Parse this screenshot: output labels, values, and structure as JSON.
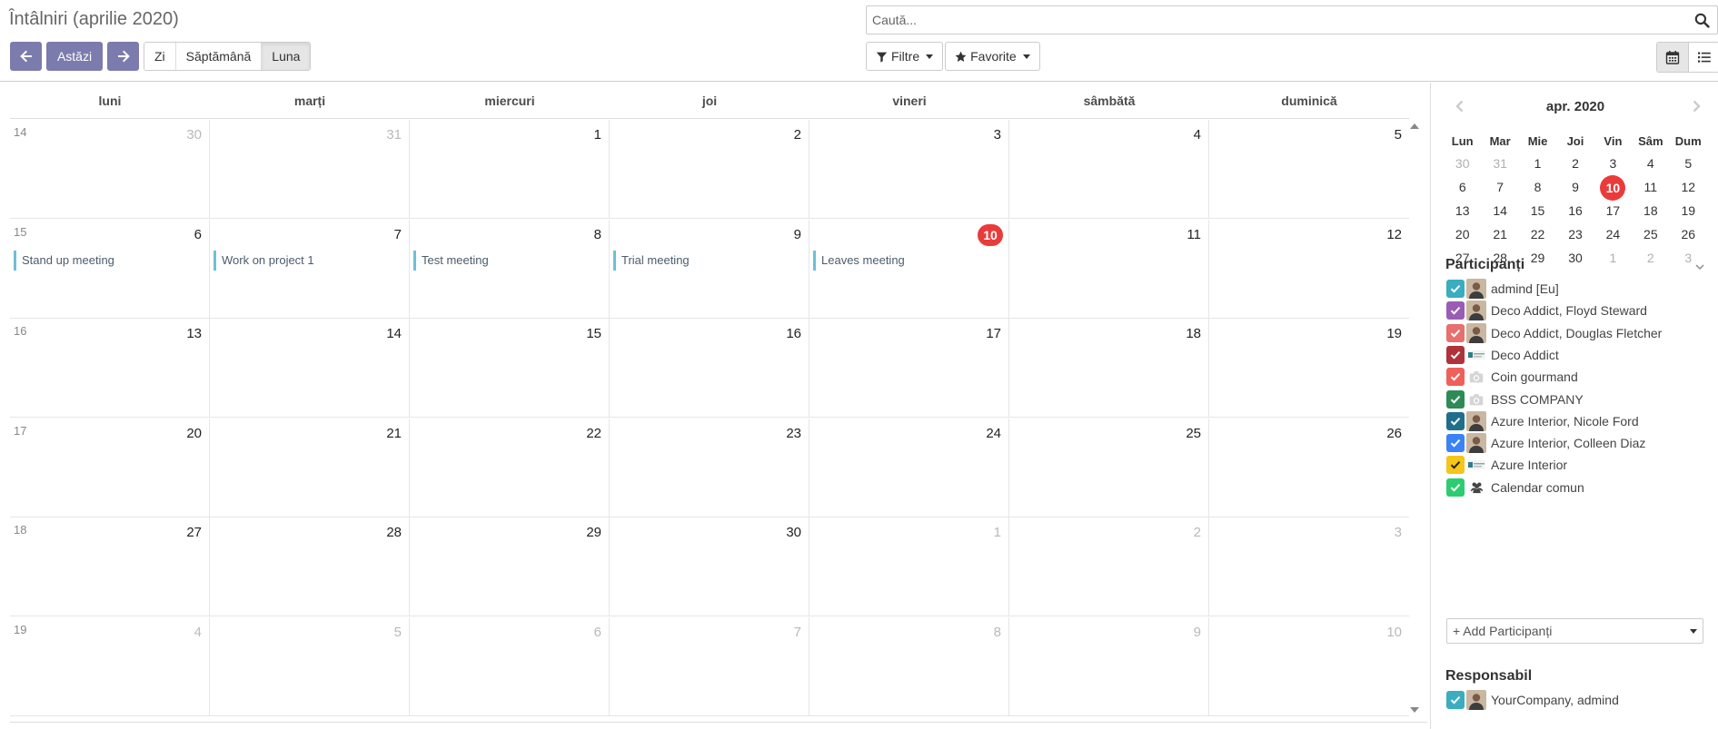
{
  "header": {
    "title": "Întâlniri (aprilie 2020)",
    "today_label": "Astăzi",
    "scales": [
      "Zi",
      "Săptămână",
      "Luna"
    ],
    "active_scale": "Luna",
    "search_placeholder": "Caută...",
    "filters_label": "Filtre",
    "favorites_label": "Favorite"
  },
  "calendar": {
    "weekdays": [
      "luni",
      "marți",
      "miercuri",
      "joi",
      "vineri",
      "sâmbătă",
      "duminică"
    ],
    "weeks": [
      {
        "week_no": "14",
        "days": [
          {
            "n": "30",
            "other": true
          },
          {
            "n": "31",
            "other": true
          },
          {
            "n": "1"
          },
          {
            "n": "2"
          },
          {
            "n": "3"
          },
          {
            "n": "4"
          },
          {
            "n": "5"
          }
        ]
      },
      {
        "week_no": "15",
        "days": [
          {
            "n": "6",
            "event": "Stand up meeting"
          },
          {
            "n": "7",
            "event": "Work on project 1"
          },
          {
            "n": "8",
            "event": "Test meeting"
          },
          {
            "n": "9",
            "event": "Trial meeting"
          },
          {
            "n": "10",
            "today": true,
            "event": "Leaves meeting"
          },
          {
            "n": "11"
          },
          {
            "n": "12"
          }
        ]
      },
      {
        "week_no": "16",
        "days": [
          {
            "n": "13"
          },
          {
            "n": "14"
          },
          {
            "n": "15"
          },
          {
            "n": "16"
          },
          {
            "n": "17"
          },
          {
            "n": "18"
          },
          {
            "n": "19"
          }
        ]
      },
      {
        "week_no": "17",
        "days": [
          {
            "n": "20"
          },
          {
            "n": "21"
          },
          {
            "n": "22"
          },
          {
            "n": "23"
          },
          {
            "n": "24"
          },
          {
            "n": "25"
          },
          {
            "n": "26"
          }
        ]
      },
      {
        "week_no": "18",
        "days": [
          {
            "n": "27"
          },
          {
            "n": "28"
          },
          {
            "n": "29"
          },
          {
            "n": "30"
          },
          {
            "n": "1",
            "other": true
          },
          {
            "n": "2",
            "other": true
          },
          {
            "n": "3",
            "other": true
          }
        ]
      },
      {
        "week_no": "19",
        "days": [
          {
            "n": "4",
            "other": true
          },
          {
            "n": "5",
            "other": true
          },
          {
            "n": "6",
            "other": true
          },
          {
            "n": "7",
            "other": true
          },
          {
            "n": "8",
            "other": true
          },
          {
            "n": "9",
            "other": true
          },
          {
            "n": "10",
            "other": true
          }
        ]
      }
    ],
    "event_color": "#6cc1d6",
    "today_color": "#ea3b3b"
  },
  "mini_calendar": {
    "title": "apr. 2020",
    "weekdays": [
      "Lun",
      "Mar",
      "Mie",
      "Joi",
      "Vin",
      "Sâm",
      "Dum"
    ],
    "rows": [
      [
        {
          "n": "30",
          "muted": true
        },
        {
          "n": "31",
          "muted": true
        },
        {
          "n": "1"
        },
        {
          "n": "2"
        },
        {
          "n": "3"
        },
        {
          "n": "4"
        },
        {
          "n": "5"
        }
      ],
      [
        {
          "n": "6"
        },
        {
          "n": "7"
        },
        {
          "n": "8"
        },
        {
          "n": "9"
        },
        {
          "n": "10",
          "current": true
        },
        {
          "n": "11"
        },
        {
          "n": "12"
        }
      ],
      [
        {
          "n": "13"
        },
        {
          "n": "14"
        },
        {
          "n": "15"
        },
        {
          "n": "16"
        },
        {
          "n": "17"
        },
        {
          "n": "18"
        },
        {
          "n": "19"
        }
      ],
      [
        {
          "n": "20"
        },
        {
          "n": "21"
        },
        {
          "n": "22"
        },
        {
          "n": "23"
        },
        {
          "n": "24"
        },
        {
          "n": "25"
        },
        {
          "n": "26"
        }
      ],
      [
        {
          "n": "27"
        },
        {
          "n": "28"
        },
        {
          "n": "29"
        },
        {
          "n": "30"
        },
        {
          "n": "1",
          "muted": true
        },
        {
          "n": "2",
          "muted": true
        },
        {
          "n": "3",
          "muted": true
        }
      ]
    ]
  },
  "attendees": {
    "title": "Participanți",
    "items": [
      {
        "label": "admind [Eu]",
        "color": "#3aadc0",
        "avatar": "person-photo-icon"
      },
      {
        "label": "Deco Addict, Floyd Steward",
        "color": "#9a5cb4",
        "avatar": "person-photo-icon"
      },
      {
        "label": "Deco Addict, Douglas Fletcher",
        "color": "#e76f6f",
        "avatar": "person-photo-icon"
      },
      {
        "label": "Deco Addict",
        "color": "#b0323a",
        "avatar": "company-logo-icon"
      },
      {
        "label": "Coin gourmand",
        "color": "#f0605a",
        "avatar": "camera-placeholder-icon"
      },
      {
        "label": "BSS COMPANY",
        "color": "#2e8b57",
        "avatar": "camera-placeholder-icon"
      },
      {
        "label": "Azure Interior, Nicole Ford",
        "color": "#1f6f8b",
        "avatar": "person-photo-icon"
      },
      {
        "label": "Azure Interior, Colleen Diaz",
        "color": "#3b82f6",
        "avatar": "person-photo-icon"
      },
      {
        "label": "Azure Interior",
        "color": "#f5c518",
        "avatar": "company-logo-icon"
      },
      {
        "label": "Calendar comun",
        "color": "#2ecc71",
        "avatar": "users-icon"
      }
    ],
    "add_label": "+ Add Participanți"
  },
  "responsible": {
    "title": "Responsabil",
    "items": [
      {
        "label": "YourCompany, admind",
        "color": "#3aadc0",
        "avatar": "person-photo-icon"
      }
    ]
  }
}
